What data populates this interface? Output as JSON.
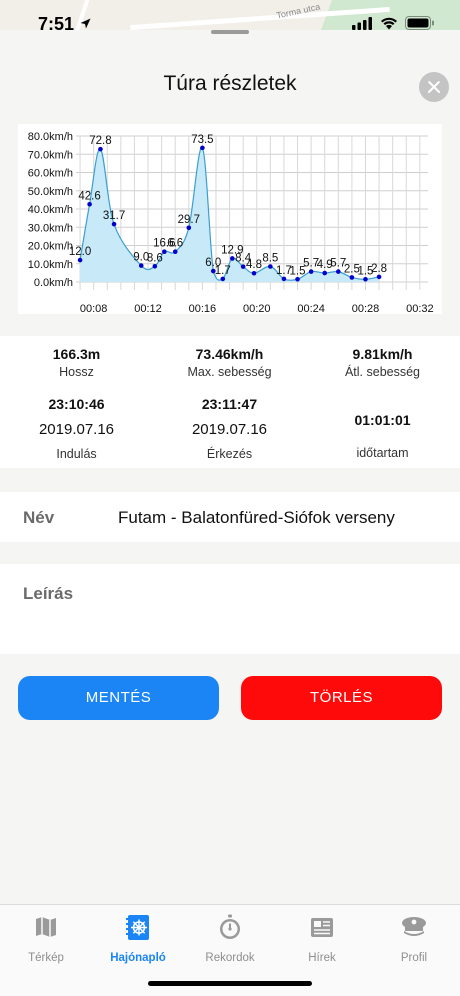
{
  "status_bar": {
    "time": "7:51"
  },
  "map": {
    "street_label": "Torma utca"
  },
  "header": {
    "title": "Túra részletek"
  },
  "chart_data": {
    "type": "line",
    "x": [
      "00:07",
      "00:07.7",
      "00:08.5",
      "00:09.5",
      "00:11.5",
      "00:12.5",
      "00:13.2",
      "00:14",
      "00:15",
      "00:16",
      "00:16.8",
      "00:17.5",
      "00:18.2",
      "00:19",
      "00:19.8",
      "00:21",
      "00:22",
      "00:23",
      "00:24",
      "00:25",
      "00:26",
      "00:27",
      "00:28",
      "00:29",
      "00:30",
      "00:31"
    ],
    "series": [
      {
        "values": [
          12.0,
          42.6,
          72.8,
          31.7,
          9.0,
          8.6,
          16.6,
          16.6,
          29.7,
          73.5,
          6.0,
          1.7,
          12.9,
          8.4,
          4.8,
          8.5,
          1.7,
          1.5,
          5.7,
          4.9,
          5.7,
          2.5,
          1.5,
          2.8
        ]
      }
    ],
    "labels": [
      "12.0",
      "42.6",
      "72.8",
      "31.7",
      "9.0",
      "8.6",
      "16.6",
      "6.6",
      "29.7",
      "73.5",
      "6.0",
      "1.7",
      "12.9",
      "8.4",
      "4.8",
      "8.5",
      "1.7",
      "1.5",
      "5.7",
      "4.9",
      "5.7",
      "2.5",
      "1.5",
      "2.8"
    ],
    "y_ticks": [
      "0.0km/h",
      "10.0km/h",
      "20.0km/h",
      "30.0km/h",
      "40.0km/h",
      "50.0km/h",
      "60.0km/h",
      "70.0km/h",
      "80.0km/h"
    ],
    "x_ticks": [
      "00:08",
      "00:12",
      "00:16",
      "00:20",
      "00:24",
      "00:28",
      "00:32"
    ],
    "ylim": [
      0,
      80
    ],
    "grid": true,
    "fill_color": "#c8e9f7",
    "line_color": "#3a9fd0",
    "point_color": "#0000cc"
  },
  "stats": {
    "distance": {
      "value": "166.3m",
      "label": "Hossz"
    },
    "max_speed": {
      "value": "73.46km/h",
      "label": "Max. sebesség"
    },
    "avg_speed": {
      "value": "9.81km/h",
      "label": "Átl. sebesség"
    },
    "start": {
      "time": "23:10:46",
      "date": "2019.07.16",
      "label": "Indulás"
    },
    "end": {
      "time": "23:11:47",
      "date": "2019.07.16",
      "label": "Érkezés"
    },
    "duration": {
      "value": "01:01:01",
      "label": "időtartam"
    }
  },
  "form": {
    "name_label": "Név",
    "name_value": "Futam - Balatonfüred-Siófok verseny",
    "description_label": "Leírás"
  },
  "buttons": {
    "save_label": "MENTÉS",
    "delete_label": "TÖRLÉS",
    "save_color": "#1b85f5",
    "delete_color": "#ff0a0a"
  },
  "tabbar": {
    "active": "Hajónapló",
    "items": [
      {
        "label": "Térkép",
        "icon": "map-icon"
      },
      {
        "label": "Hajónapló",
        "icon": "logbook-icon"
      },
      {
        "label": "Rekordok",
        "icon": "stopwatch-icon"
      },
      {
        "label": "Hírek",
        "icon": "news-icon"
      },
      {
        "label": "Profil",
        "icon": "captain-hat-icon"
      }
    ]
  }
}
